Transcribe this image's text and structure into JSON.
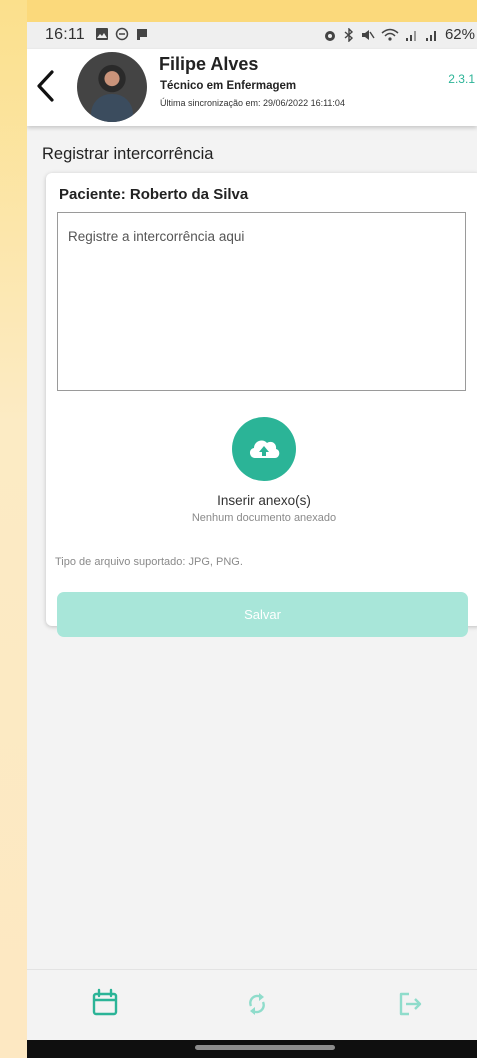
{
  "status_bar": {
    "time": "16:11",
    "battery": "62%"
  },
  "header": {
    "user_name": "Filipe Alves",
    "user_role": "Técnico em Enfermagem",
    "last_sync": "Última sincronização em: 29/06/2022 16:11:04",
    "version": "2.3.1"
  },
  "page": {
    "title": "Registrar intercorrência"
  },
  "form": {
    "patient_label": "Paciente: Roberto da Silva",
    "textarea_placeholder": "Registre a intercorrência aqui",
    "textarea_value": "",
    "attach_label": "Inserir anexo(s)",
    "attach_status": "Nenhum documento anexado",
    "file_types": "Tipo de arquivo suportado: JPG, PNG.",
    "save_label": "Salvar"
  },
  "bottom_nav": {
    "items": [
      {
        "icon": "calendar-icon"
      },
      {
        "icon": "sync-icon"
      },
      {
        "icon": "logout-icon"
      }
    ]
  },
  "colors": {
    "accent": "#2bb497",
    "save_disabled": "#a8e6d9",
    "background": "#f3f3f3",
    "desktop_background": "#fbe3b4"
  }
}
